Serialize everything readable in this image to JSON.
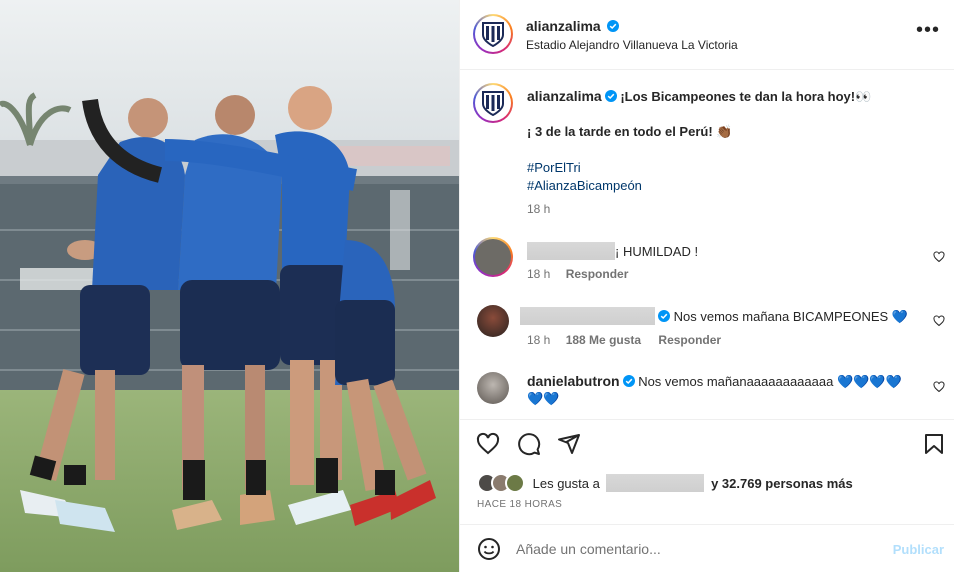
{
  "post": {
    "username": "alianzalima",
    "location": "Estadio Alejandro Villanueva La Victoria",
    "caption_line1": "¡Los Bicampeones te dan la hora hoy!👀",
    "caption_line2": "¡ 3 de la tarde en todo el Perú! 👏🏾",
    "hashtag1": "#PorElTri",
    "hashtag2": "#AlianzaBicampeón",
    "caption_time": "18 h"
  },
  "comments": [
    {
      "username_hidden": true,
      "text": "¡ HUMILDAD !",
      "time": "18 h",
      "likes": "",
      "reply": "Responder"
    },
    {
      "username_hidden": true,
      "text": "Nos vemos mañana BICAMPEONES 💙",
      "time": "18 h",
      "likes": "188 Me gusta",
      "reply": "Responder"
    },
    {
      "username": "danielabutron",
      "text_line1": "Nos vemos mañanaaaaaaaaaaaa 💙💙💙💙",
      "text_line2": "💙💙"
    }
  ],
  "likes": {
    "prefix": "Les gusta a",
    "suffix": "y 32.769 personas más"
  },
  "timestamp": "HACE 18 HORAS",
  "add_comment": {
    "placeholder": "Añade un comentario...",
    "publish": "Publicar"
  },
  "icons": {
    "like": "heart-icon",
    "comment": "comment-icon",
    "share": "send-icon",
    "save": "bookmark-icon",
    "emoji": "emoji-icon",
    "more": "more-options-icon",
    "verified": "verified-badge-icon"
  },
  "colors": {
    "verified_blue": "#0095f6",
    "hashtag_blue": "#00376b",
    "publish_disabled": "#b2dffc",
    "secondary_text": "#737373"
  }
}
